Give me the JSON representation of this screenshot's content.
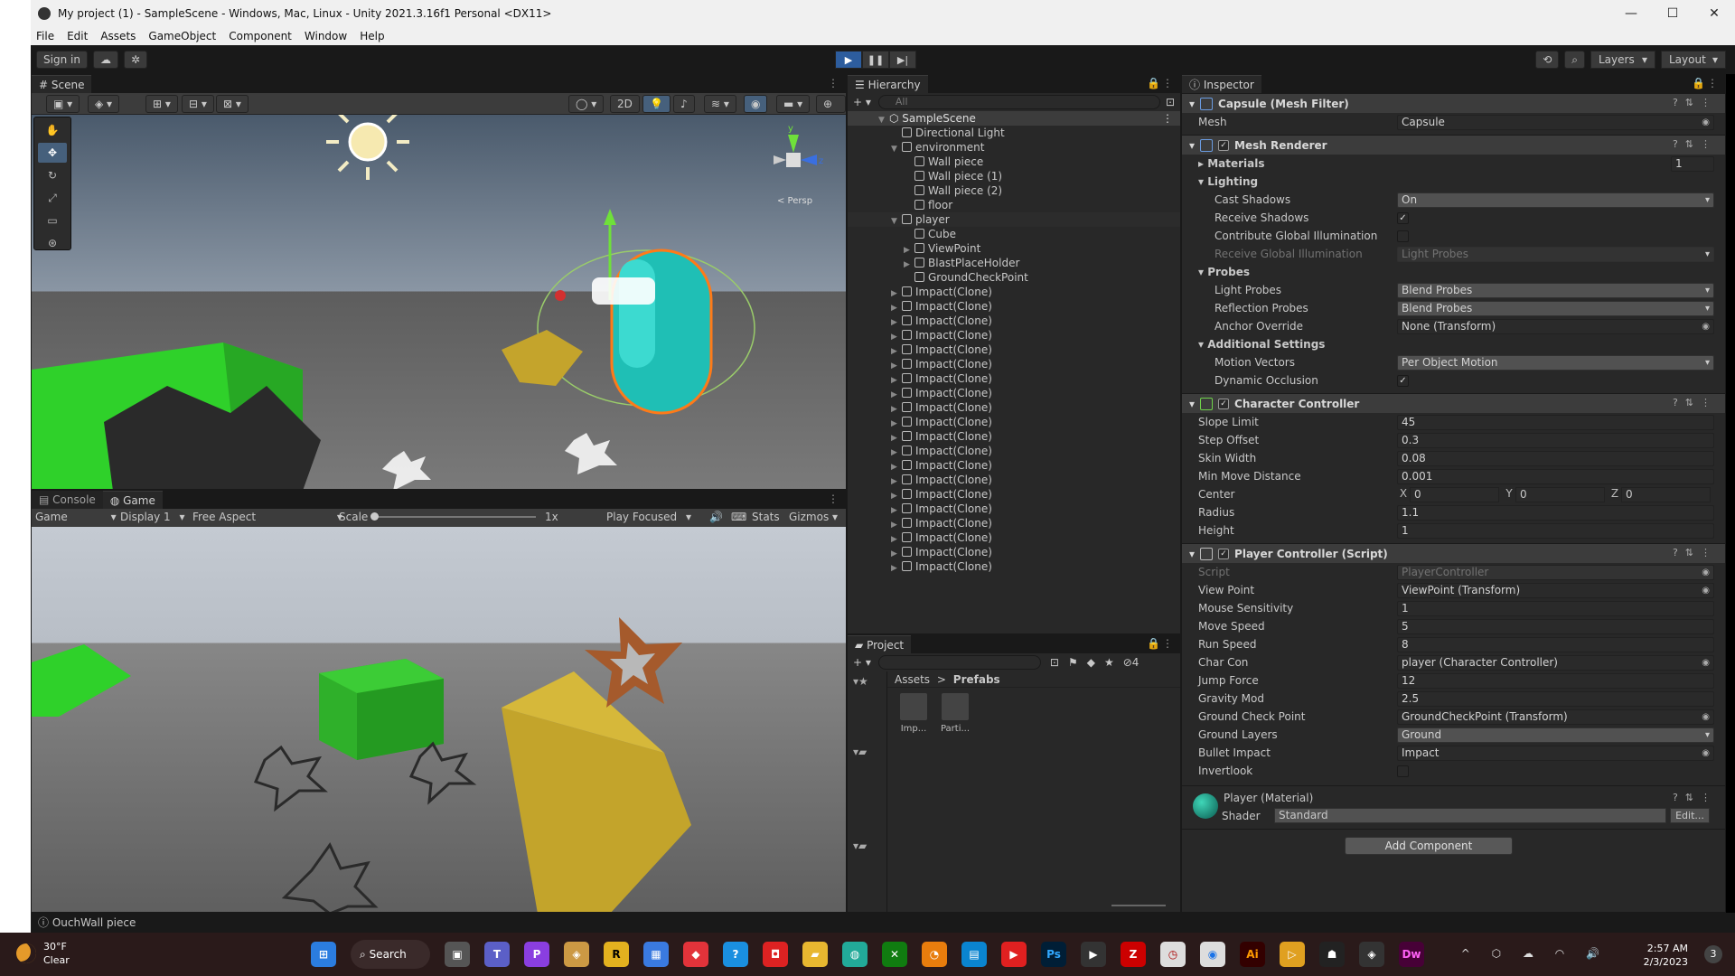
{
  "window": {
    "title": "My project (1) - SampleScene - Windows, Mac, Linux - Unity 2021.3.16f1 Personal <DX11>",
    "minimize": "—",
    "maximize": "☐",
    "close": "✕"
  },
  "menu": [
    "File",
    "Edit",
    "Assets",
    "GameObject",
    "Component",
    "Window",
    "Help"
  ],
  "toolbar": {
    "sign_in": "Sign in",
    "play_icon": "▶",
    "pause_icon": "❚❚",
    "step_icon": "▶|",
    "layers": "Layers",
    "layout": "Layout"
  },
  "scene": {
    "tab": "Scene",
    "mode_2d": "2D",
    "gizmo_label": "< Persp",
    "axis_y": "y",
    "axis_z": "z"
  },
  "game": {
    "tab_console": "Console",
    "tab_game": "Game",
    "mode": "Game",
    "display": "Display 1",
    "aspect": "Free Aspect",
    "scale_label": "Scale",
    "scale_value": "1x",
    "play_focused": "Play Focused",
    "stats": "Stats",
    "gizmos": "Gizmos"
  },
  "hierarchy": {
    "tab": "Hierarchy",
    "search_placeholder": "All",
    "scene_name": "SampleScene",
    "items": [
      {
        "label": "Directional Light",
        "depth": 1,
        "expand": ""
      },
      {
        "label": "environment",
        "depth": 1,
        "expand": "▼"
      },
      {
        "label": "Wall piece",
        "depth": 2,
        "expand": ""
      },
      {
        "label": "Wall piece (1)",
        "depth": 2,
        "expand": ""
      },
      {
        "label": "Wall piece (2)",
        "depth": 2,
        "expand": ""
      },
      {
        "label": "floor",
        "depth": 2,
        "expand": ""
      },
      {
        "label": "player",
        "depth": 1,
        "expand": "▼",
        "selected": true
      },
      {
        "label": "Cube",
        "depth": 2,
        "expand": ""
      },
      {
        "label": "ViewPoint",
        "depth": 2,
        "expand": "▶"
      },
      {
        "label": "BlastPlaceHolder",
        "depth": 2,
        "expand": "▶"
      },
      {
        "label": "GroundCheckPoint",
        "depth": 2,
        "expand": ""
      },
      {
        "label": "Impact(Clone)",
        "depth": 1,
        "expand": "▶"
      },
      {
        "label": "Impact(Clone)",
        "depth": 1,
        "expand": "▶"
      },
      {
        "label": "Impact(Clone)",
        "depth": 1,
        "expand": "▶"
      },
      {
        "label": "Impact(Clone)",
        "depth": 1,
        "expand": "▶"
      },
      {
        "label": "Impact(Clone)",
        "depth": 1,
        "expand": "▶"
      },
      {
        "label": "Impact(Clone)",
        "depth": 1,
        "expand": "▶"
      },
      {
        "label": "Impact(Clone)",
        "depth": 1,
        "expand": "▶"
      },
      {
        "label": "Impact(Clone)",
        "depth": 1,
        "expand": "▶"
      },
      {
        "label": "Impact(Clone)",
        "depth": 1,
        "expand": "▶"
      },
      {
        "label": "Impact(Clone)",
        "depth": 1,
        "expand": "▶"
      },
      {
        "label": "Impact(Clone)",
        "depth": 1,
        "expand": "▶"
      },
      {
        "label": "Impact(Clone)",
        "depth": 1,
        "expand": "▶"
      },
      {
        "label": "Impact(Clone)",
        "depth": 1,
        "expand": "▶"
      },
      {
        "label": "Impact(Clone)",
        "depth": 1,
        "expand": "▶"
      },
      {
        "label": "Impact(Clone)",
        "depth": 1,
        "expand": "▶"
      },
      {
        "label": "Impact(Clone)",
        "depth": 1,
        "expand": "▶"
      },
      {
        "label": "Impact(Clone)",
        "depth": 1,
        "expand": "▶"
      },
      {
        "label": "Impact(Clone)",
        "depth": 1,
        "expand": "▶"
      },
      {
        "label": "Impact(Clone)",
        "depth": 1,
        "expand": "▶"
      },
      {
        "label": "Impact(Clone)",
        "depth": 1,
        "expand": "▶"
      }
    ]
  },
  "project": {
    "tab": "Project",
    "crumb_root": "Assets",
    "crumb_sep": ">",
    "crumb_folder": "Prefabs",
    "assets": [
      "Imp...",
      "Parti..."
    ],
    "hidden_count": "4"
  },
  "inspector": {
    "tab": "Inspector",
    "mesh_filter": {
      "title": "Capsule (Mesh Filter)",
      "mesh_label": "Mesh",
      "mesh_value": "Capsule"
    },
    "mesh_renderer": {
      "title": "Mesh Renderer",
      "materials_label": "Materials",
      "materials_count": "1",
      "lighting_label": "Lighting",
      "cast_shadows_label": "Cast Shadows",
      "cast_shadows_value": "On",
      "receive_shadows_label": "Receive Shadows",
      "contribute_gi_label": "Contribute Global Illumination",
      "receive_gi_label": "Receive Global Illumination",
      "receive_gi_value": "Light Probes",
      "probes_label": "Probes",
      "light_probes_label": "Light Probes",
      "light_probes_value": "Blend Probes",
      "reflection_probes_label": "Reflection Probes",
      "reflection_probes_value": "Blend Probes",
      "anchor_override_label": "Anchor Override",
      "anchor_override_value": "None (Transform)",
      "additional_label": "Additional Settings",
      "motion_vectors_label": "Motion Vectors",
      "motion_vectors_value": "Per Object Motion",
      "dynamic_occlusion_label": "Dynamic Occlusion"
    },
    "character_controller": {
      "title": "Character Controller",
      "slope_limit_label": "Slope Limit",
      "slope_limit": "45",
      "step_offset_label": "Step Offset",
      "step_offset": "0.3",
      "skin_width_label": "Skin Width",
      "skin_width": "0.08",
      "min_move_label": "Min Move Distance",
      "min_move": "0.001",
      "center_label": "Center",
      "center_x": "0",
      "center_y": "0",
      "center_z": "0",
      "radius_label": "Radius",
      "radius": "1.1",
      "height_label": "Height",
      "height": "1"
    },
    "player_controller": {
      "title": "Player Controller (Script)",
      "script_label": "Script",
      "script_value": "PlayerController",
      "view_point_label": "View Point",
      "view_point": "ViewPoint (Transform)",
      "mouse_sens_label": "Mouse Sensitivity",
      "mouse_sens": "1",
      "move_speed_label": "Move Speed",
      "move_speed": "5",
      "run_speed_label": "Run Speed",
      "run_speed": "8",
      "char_con_label": "Char Con",
      "char_con": "player (Character Controller)",
      "jump_force_label": "Jump Force",
      "jump_force": "12",
      "gravity_mod_label": "Gravity Mod",
      "gravity_mod": "2.5",
      "ground_check_label": "Ground Check Point",
      "ground_check": "GroundCheckPoint (Transform)",
      "ground_layers_label": "Ground Layers",
      "ground_layers": "Ground",
      "bullet_impact_label": "Bullet Impact",
      "bullet_impact": "Impact",
      "invertlook_label": "Invertlook"
    },
    "material": {
      "title": "Player (Material)",
      "shader_label": "Shader",
      "shader_value": "Standard",
      "edit": "Edit..."
    },
    "add_component": "Add Component"
  },
  "status": {
    "message": "OuchWall piece"
  },
  "taskbar": {
    "temperature": "30°F",
    "condition": "Clear",
    "search": "Search",
    "time": "2:57 AM",
    "date": "2/3/2023",
    "notification_count": "3"
  },
  "colors": {
    "accent": "#2d5d9e",
    "capsule": "#1fbfb5",
    "ground_green": "#2fd12a"
  }
}
